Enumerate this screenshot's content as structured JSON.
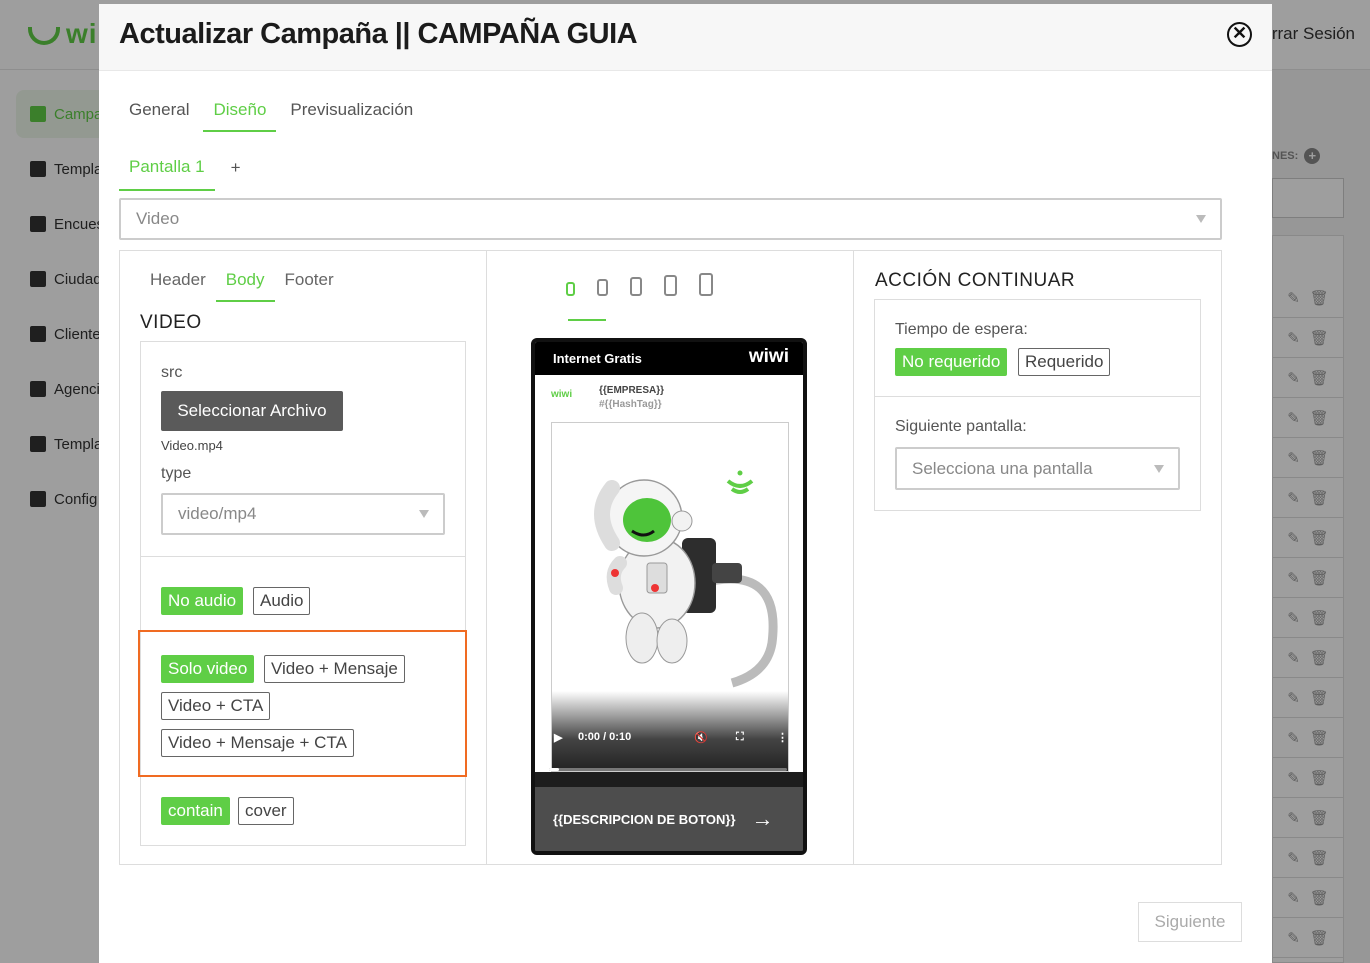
{
  "background": {
    "logo_text": "wi",
    "logout_label": "rrar Sesión",
    "sidebar": [
      {
        "label": "Campa",
        "active": true
      },
      {
        "label": "Templa",
        "active": false
      },
      {
        "label": "Encues",
        "active": false
      },
      {
        "label": "Ciudad",
        "active": false
      },
      {
        "label": "Cliente",
        "active": false
      },
      {
        "label": "Agenci",
        "active": false
      },
      {
        "label": "Templa",
        "active": false
      },
      {
        "label": "Config",
        "active": false
      }
    ],
    "right_label": "NES:"
  },
  "modal": {
    "title": "Actualizar Campaña || CAMPAÑA GUIA",
    "close_icon": "✕",
    "tabs": [
      {
        "label": "General",
        "active": false
      },
      {
        "label": "Diseño",
        "active": true
      },
      {
        "label": "Previsualización",
        "active": false
      }
    ],
    "screen_tab": "Pantalla 1",
    "screen_add": "+",
    "component_select": "Video",
    "next_label": "Siguiente"
  },
  "left": {
    "subtabs": [
      {
        "label": "Header",
        "active": false
      },
      {
        "label": "Body",
        "active": true
      },
      {
        "label": "Footer",
        "active": false
      }
    ],
    "section_title": "VIDEO",
    "src_label": "src",
    "file_button": "Seleccionar Archivo",
    "file_name": "Video.mp4",
    "type_label": "type",
    "type_value": "video/mp4",
    "audio_options": [
      {
        "label": "No audio",
        "active": true
      },
      {
        "label": "Audio",
        "active": false
      }
    ],
    "layout_options": [
      {
        "label": "Solo video",
        "active": true
      },
      {
        "label": "Video + Mensaje",
        "active": false
      },
      {
        "label": "Video + CTA",
        "active": false
      },
      {
        "label": "Video + Mensaje + CTA",
        "active": false
      }
    ],
    "fit_options": [
      {
        "label": "contain",
        "active": true
      },
      {
        "label": "cover",
        "active": false
      }
    ]
  },
  "preview": {
    "header_title": "Internet Gratis",
    "header_logo": "wiwi",
    "brand": "wiwi",
    "company": "{{EMPRESA}}",
    "hashtag": "#{{HashTag}}",
    "time": "0:00 / 0:10",
    "progress": 0.04,
    "cta_label": "{{DESCRIPCION DE BOTON}}",
    "cta_arrow": "→"
  },
  "right": {
    "section_title": "ACCIÓN CONTINUAR",
    "wait_label": "Tiempo de espera:",
    "wait_options": [
      {
        "label": "No requerido",
        "active": true
      },
      {
        "label": "Requerido",
        "active": false
      }
    ],
    "next_screen_label": "Siguiente pantalla:",
    "next_screen_placeholder": "Selecciona una pantalla"
  },
  "colors": {
    "accent": "#5fce46",
    "highlight": "#f06b22"
  }
}
